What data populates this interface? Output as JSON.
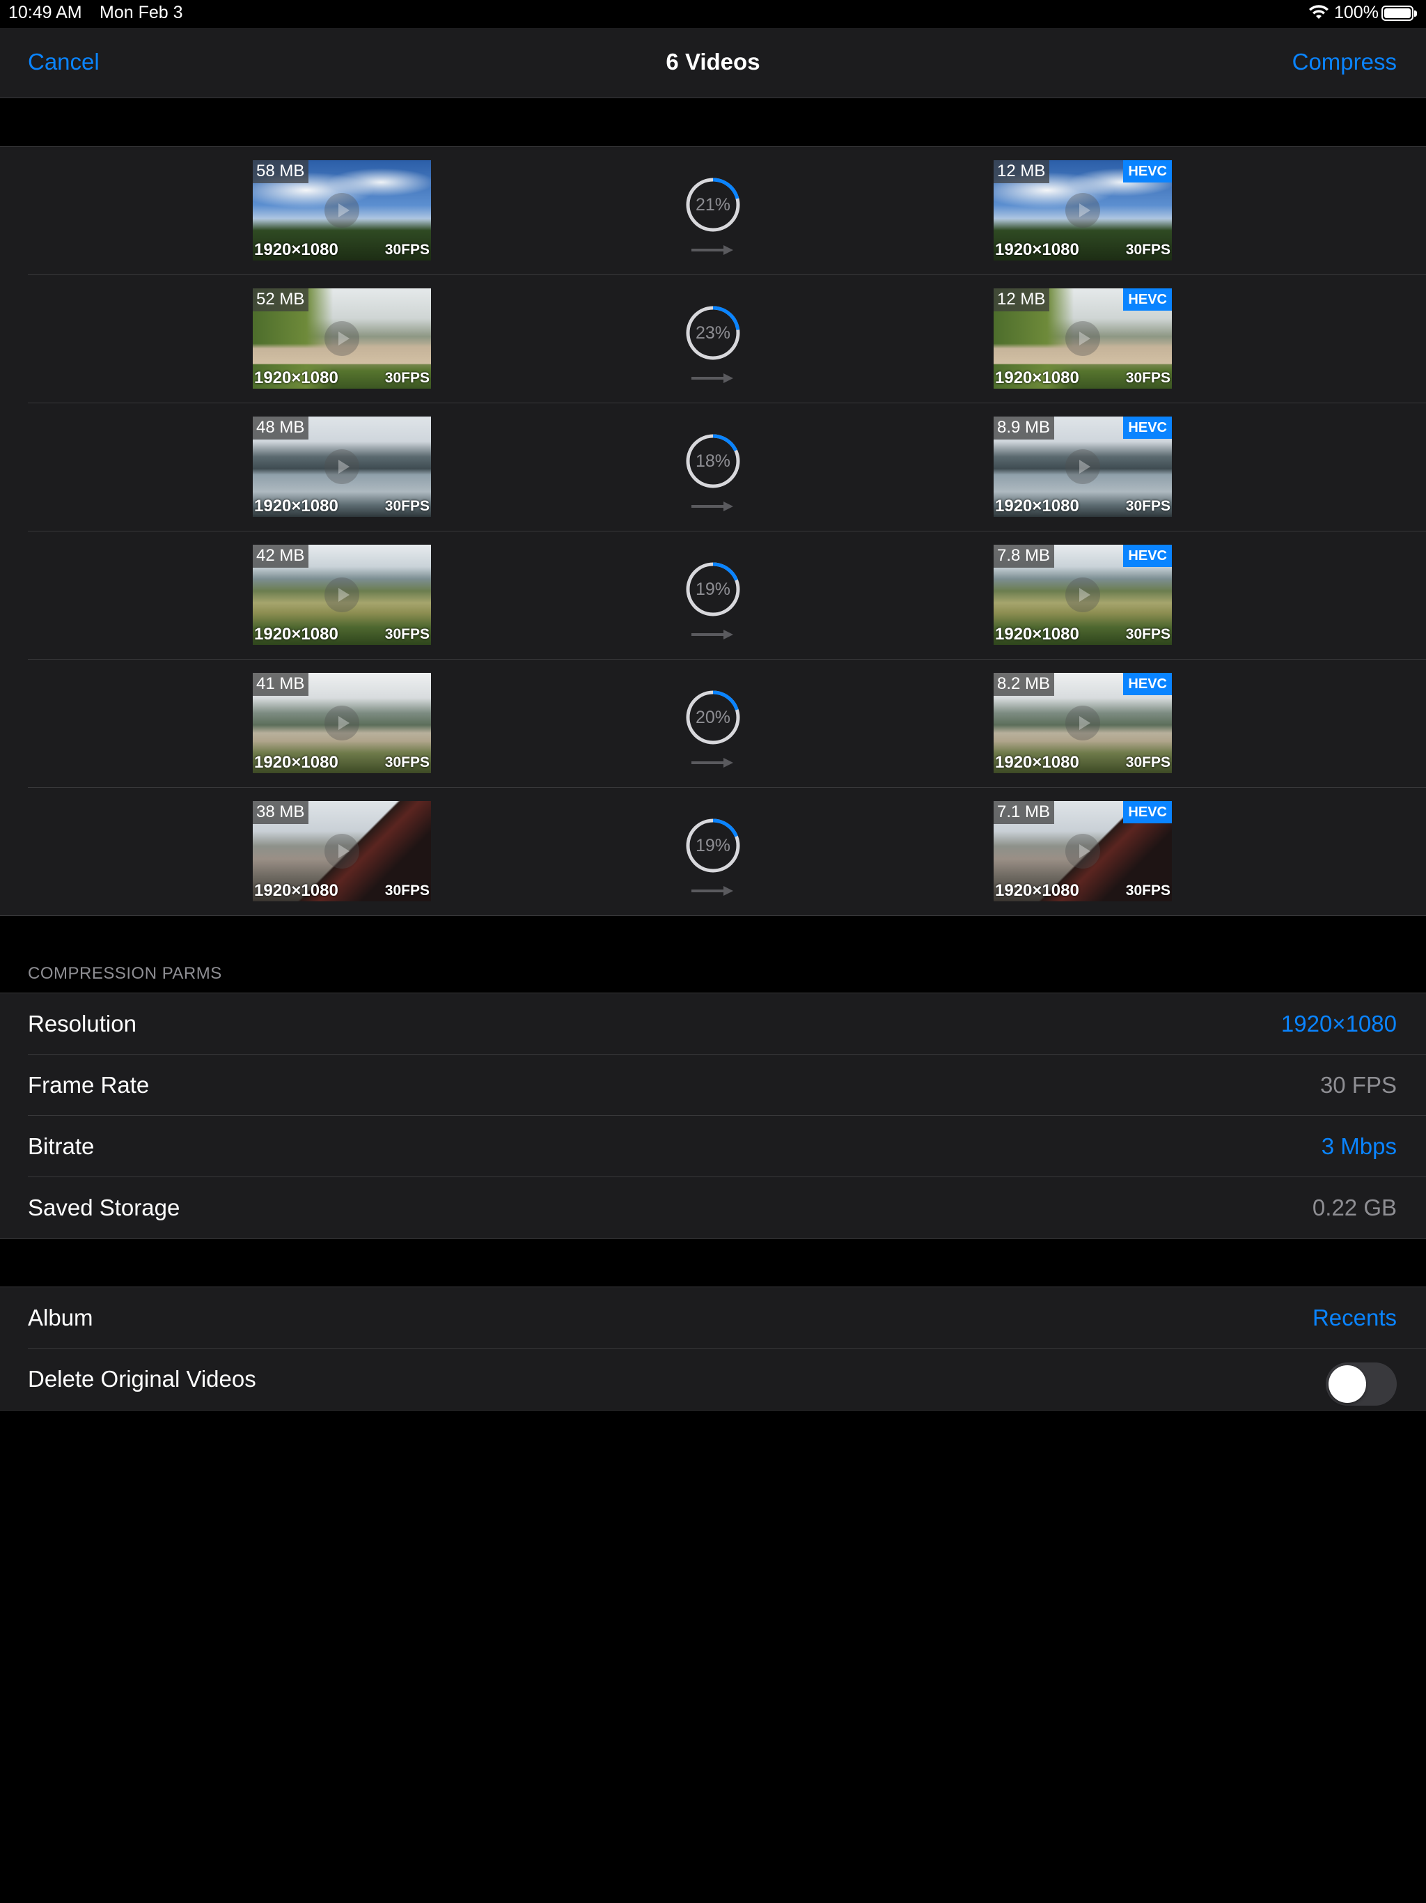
{
  "status_bar": {
    "time": "10:49 AM",
    "date": "Mon Feb 3",
    "battery_percent": "100%",
    "wifi_icon": "wifi-icon",
    "battery_icon": "battery-icon"
  },
  "nav": {
    "cancel_label": "Cancel",
    "title": "6 Videos",
    "compress_label": "Compress"
  },
  "videos": [
    {
      "src_size": "58 MB",
      "dst_size": "12 MB",
      "resolution": "1920×1080",
      "fps": "30FPS",
      "codec": "HEVC",
      "progress_label": "21%",
      "progress": 0.21
    },
    {
      "src_size": "52 MB",
      "dst_size": "12 MB",
      "resolution": "1920×1080",
      "fps": "30FPS",
      "codec": "HEVC",
      "progress_label": "23%",
      "progress": 0.23
    },
    {
      "src_size": "48 MB",
      "dst_size": "8.9 MB",
      "resolution": "1920×1080",
      "fps": "30FPS",
      "codec": "HEVC",
      "progress_label": "18%",
      "progress": 0.18
    },
    {
      "src_size": "42 MB",
      "dst_size": "7.8 MB",
      "resolution": "1920×1080",
      "fps": "30FPS",
      "codec": "HEVC",
      "progress_label": "19%",
      "progress": 0.19
    },
    {
      "src_size": "41 MB",
      "dst_size": "8.2 MB",
      "resolution": "1920×1080",
      "fps": "30FPS",
      "codec": "HEVC",
      "progress_label": "20%",
      "progress": 0.2
    },
    {
      "src_size": "38 MB",
      "dst_size": "7.1 MB",
      "resolution": "1920×1080",
      "fps": "30FPS",
      "codec": "HEVC",
      "progress_label": "19%",
      "progress": 0.19
    }
  ],
  "compression_params": {
    "header": "COMPRESSION PARMS",
    "rows": [
      {
        "label": "Resolution",
        "value": "1920×1080"
      },
      {
        "label": "Frame Rate",
        "value": "30 FPS"
      },
      {
        "label": "Bitrate",
        "value": "3 Mbps"
      },
      {
        "label": "Saved Storage",
        "value": "0.22 GB"
      }
    ]
  },
  "options": {
    "album_label": "Album",
    "album_value": "Recents",
    "delete_label": "Delete Original Videos",
    "delete_enabled": false
  },
  "colors": {
    "accent": "#0a84ff",
    "background": "#000000",
    "cell": "#1c1c1e",
    "secondary_text": "#8e8e93"
  }
}
